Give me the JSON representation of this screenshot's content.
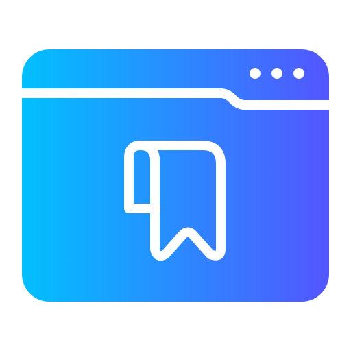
{
  "icon": {
    "name": "browser-bookmark-icon",
    "parts": [
      "browser-window",
      "window-menu-dots",
      "tab-divider",
      "bookmark-icon"
    ]
  },
  "colors": {
    "gradient_start": "#01c0ff",
    "gradient_end": "#5356ff",
    "stroke": "#ffffff",
    "background": "#ffffff"
  }
}
